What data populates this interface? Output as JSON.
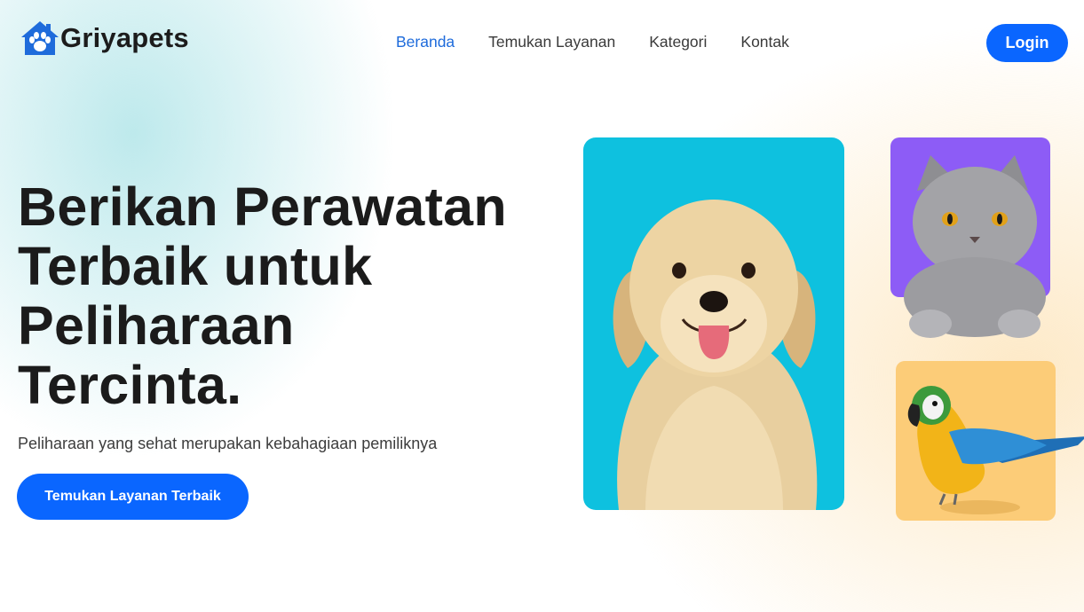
{
  "brand": {
    "name": "Griyapets",
    "logo_icon": "house-paw-icon",
    "color": "#1e6bdb"
  },
  "nav": {
    "items": [
      {
        "label": "Beranda",
        "active": true
      },
      {
        "label": "Temukan Layanan",
        "active": false
      },
      {
        "label": "Kategori",
        "active": false
      },
      {
        "label": "Kontak",
        "active": false
      }
    ],
    "login_label": "Login"
  },
  "hero": {
    "title": "Berikan Perawatan Terbaik untuk Peliharaan Tercinta.",
    "subtitle": "Peliharaan yang sehat merupakan kebahagiaan pemiliknya",
    "cta_label": "Temukan Layanan Terbaik"
  },
  "images": [
    {
      "subject": "golden-retriever-puppy",
      "background": "#0ec1df"
    },
    {
      "subject": "grey-cat",
      "background": "#8d5cf6"
    },
    {
      "subject": "macaw-parrot",
      "background": "#fccc78"
    }
  ],
  "colors": {
    "accent": "#0a66ff",
    "text": "#1b1b1b"
  }
}
